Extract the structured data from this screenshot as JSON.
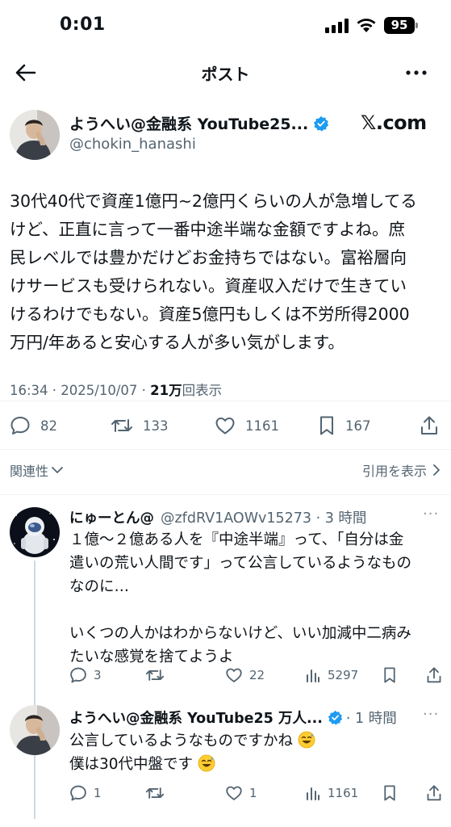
{
  "status": {
    "time": "0:01",
    "battery": "95"
  },
  "header": {
    "title": "ポスト"
  },
  "post": {
    "author_name": "ようへい@金融系 YouTube25...",
    "author_handle": "@chokin_hanashi",
    "watermark": "𝕏.com",
    "text_lines": [
      "30代40代で資産1億円~2億円くらいの人が急増してる",
      "けど、正直に言って一番中途半端な金額ですよね。庶",
      "民レベルでは豊かだけどお金持ちではない。富裕層向",
      "けサービスも受けられない。資産収入だけで生きてい",
      "けるわけでもない。資産5億円もしくは不労所得2000",
      "万円/年あると安心する人が多い気がします。"
    ],
    "timestamp": "16:34 · 2025/10/07 · ",
    "views_count": "21万",
    "views_label": "回表示",
    "replies": "82",
    "reposts": "133",
    "likes": "1161",
    "bookmarks": "167"
  },
  "related": {
    "left_label": "関連性",
    "right_label": "引用を表示"
  },
  "replies": [
    {
      "name": "にゅーとん@",
      "handle": "@zfdRV1AOWv15273 · 3 時間",
      "lines": [
        "１億〜２億ある人を『中途半端』って、「自分は金",
        "遣いの荒い人間です」って公言しているようなもの",
        "なのに…",
        "",
        "いくつの人かはわからないけど、いい加減中二病み",
        "たいな感覚を捨てようよ"
      ],
      "replies": "3",
      "reposts": "",
      "likes": "22",
      "views": "5297"
    },
    {
      "name": "ようへい@金融系 YouTube25 万人...",
      "handle": "· 1 時間",
      "lines": [
        "公言しているようなものですかね",
        "僕は30代中盤です"
      ],
      "replies": "1",
      "reposts": "",
      "likes": "1",
      "views": "1161"
    }
  ],
  "colors": {
    "accent": "#1d9bf0",
    "muted": "#536471",
    "text": "#0f1419"
  }
}
